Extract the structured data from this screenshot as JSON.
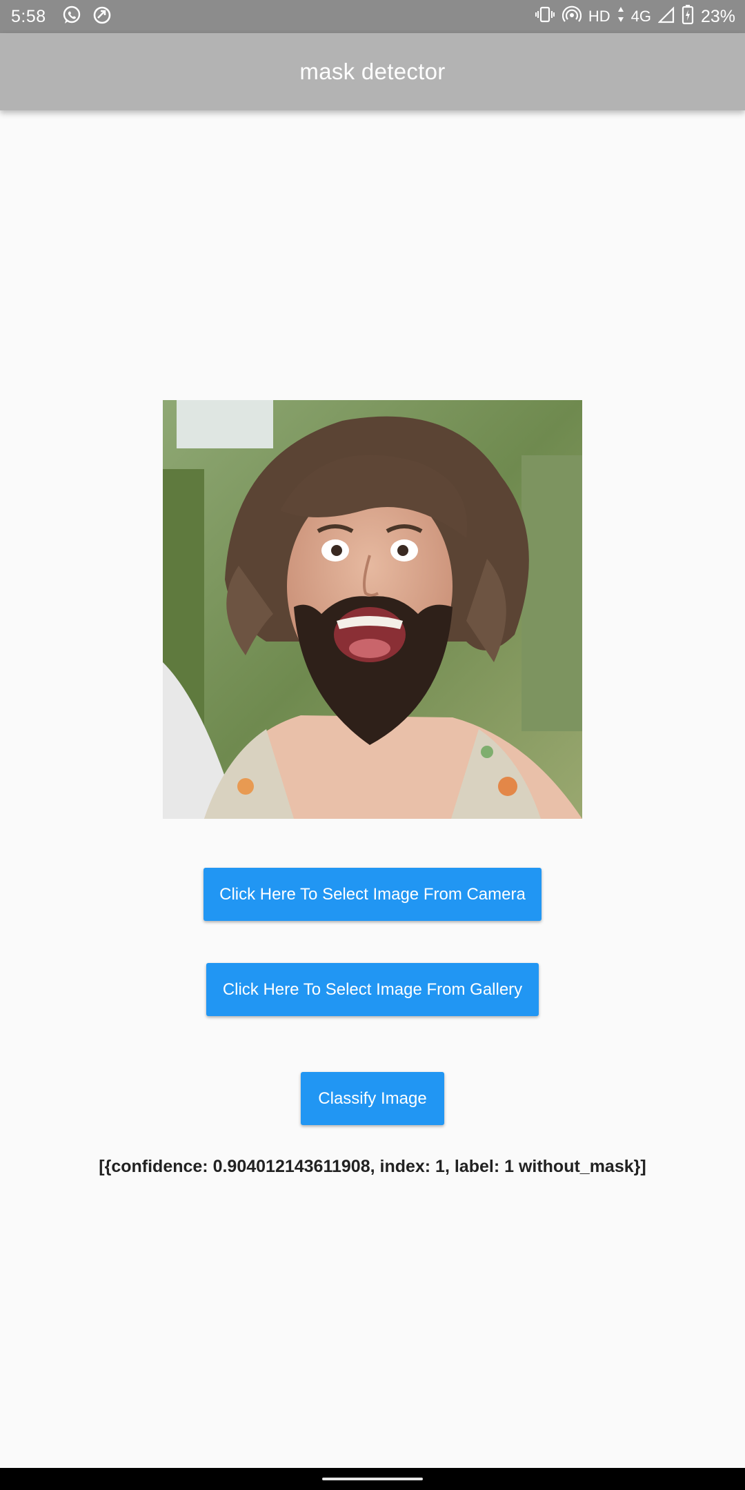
{
  "status_bar": {
    "time": "5:58",
    "left_icons": [
      "whatsapp-icon",
      "sync-icon"
    ],
    "right_icons": [
      "vibrate-icon",
      "hotspot-icon",
      "signal-icon",
      "battery-charging-icon"
    ],
    "hd_label": "HD",
    "network_label": "4G",
    "battery_percent": "23%"
  },
  "app_bar": {
    "title": "mask detector",
    "background": "#b3b3b3"
  },
  "image_preview": {
    "description_icon": "selected-photo"
  },
  "actions": {
    "camera_label": "Click Here To Select Image From Camera",
    "gallery_label": "Click Here To Select Image From Gallery",
    "classify_label": "Classify Image",
    "button_color": "#2196f3"
  },
  "result": {
    "text": "[{confidence: 0.904012143611908, index: 1, label: 1 without_mask}]"
  }
}
